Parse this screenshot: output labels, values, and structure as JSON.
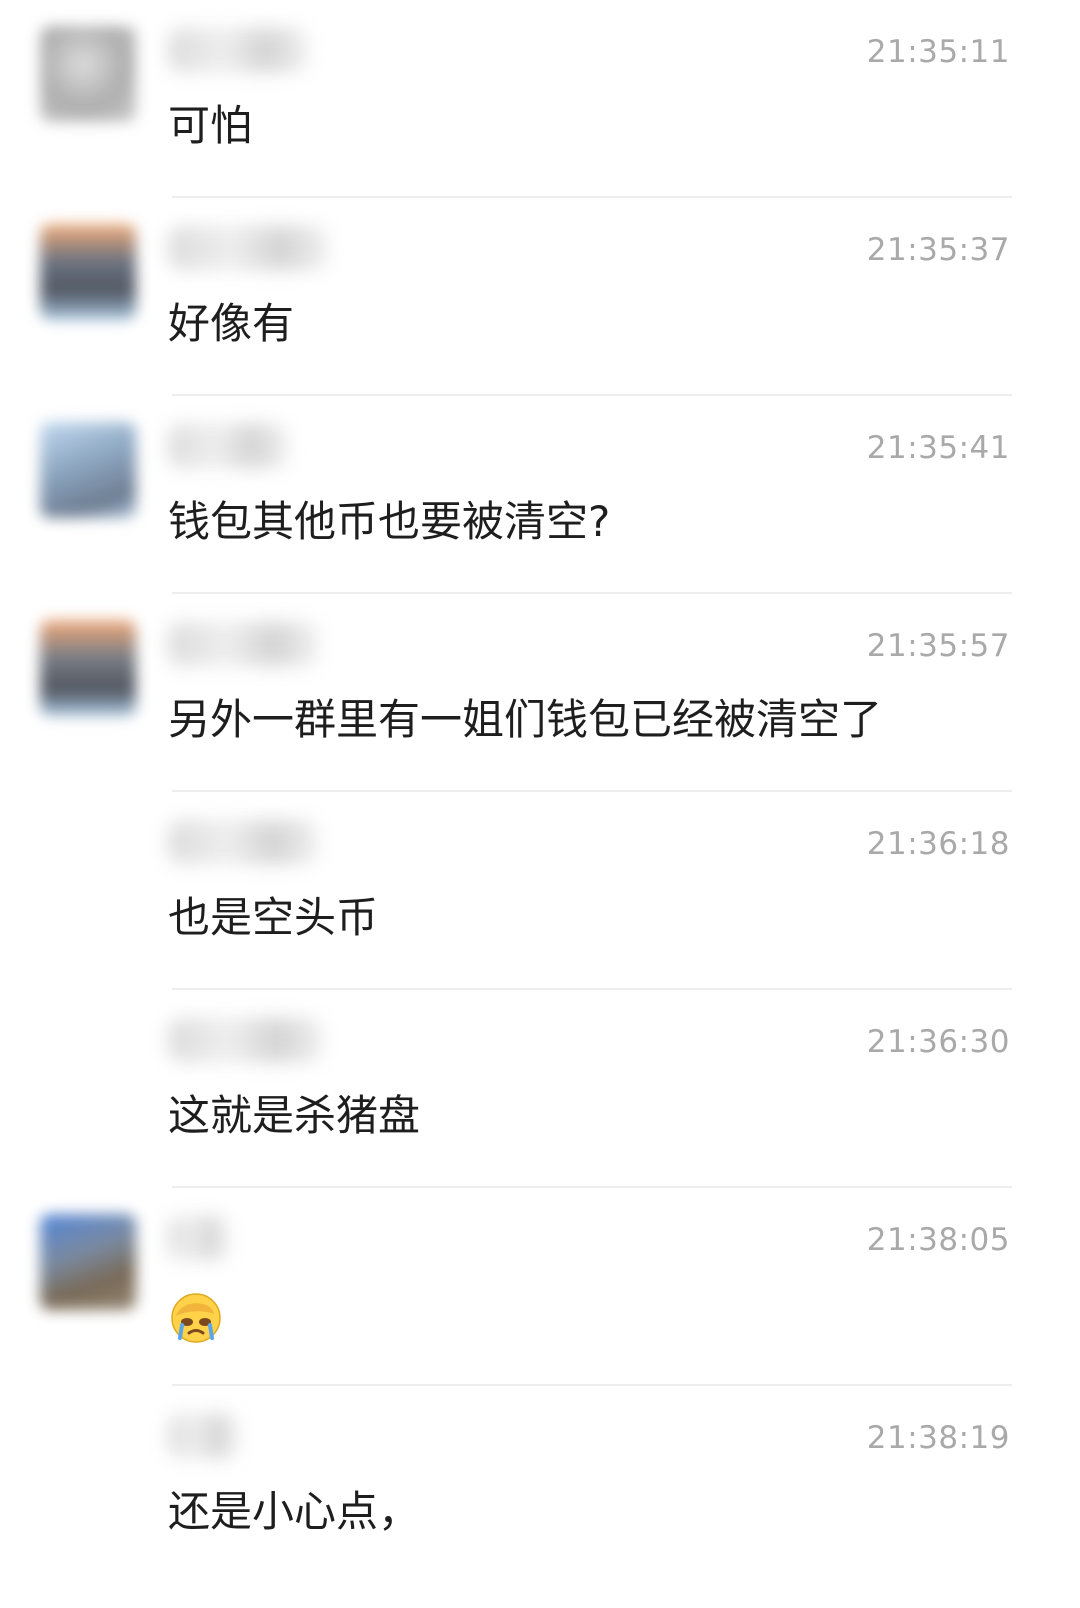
{
  "messages": [
    {
      "time": "21:35:11",
      "text": "可怕",
      "avatar_color": "#a9a9a9",
      "has_avatar": true
    },
    {
      "time": "21:35:37",
      "text": "好像有",
      "avatar_color": "#8a8f9a",
      "has_avatar": true
    },
    {
      "time": "21:35:41",
      "text": "钱包其他币也要被清空?",
      "avatar_color": "#9ab4cc",
      "has_avatar": true
    },
    {
      "time": "21:35:57",
      "text": "另外一群里有一姐们钱包已经被清空了",
      "avatar_color": "#7c7f87",
      "has_avatar": true
    },
    {
      "time": "21:36:18",
      "text": "也是空头币",
      "has_avatar": false
    },
    {
      "time": "21:36:30",
      "text": "这就是杀猪盘",
      "has_avatar": false
    },
    {
      "time": "21:38:05",
      "text": "",
      "emoji": "facepalm-crying-emoji",
      "avatar_color": "#4a6fae",
      "has_avatar": true
    },
    {
      "time": "21:38:19",
      "text": "还是小心点，",
      "has_avatar": false
    }
  ]
}
